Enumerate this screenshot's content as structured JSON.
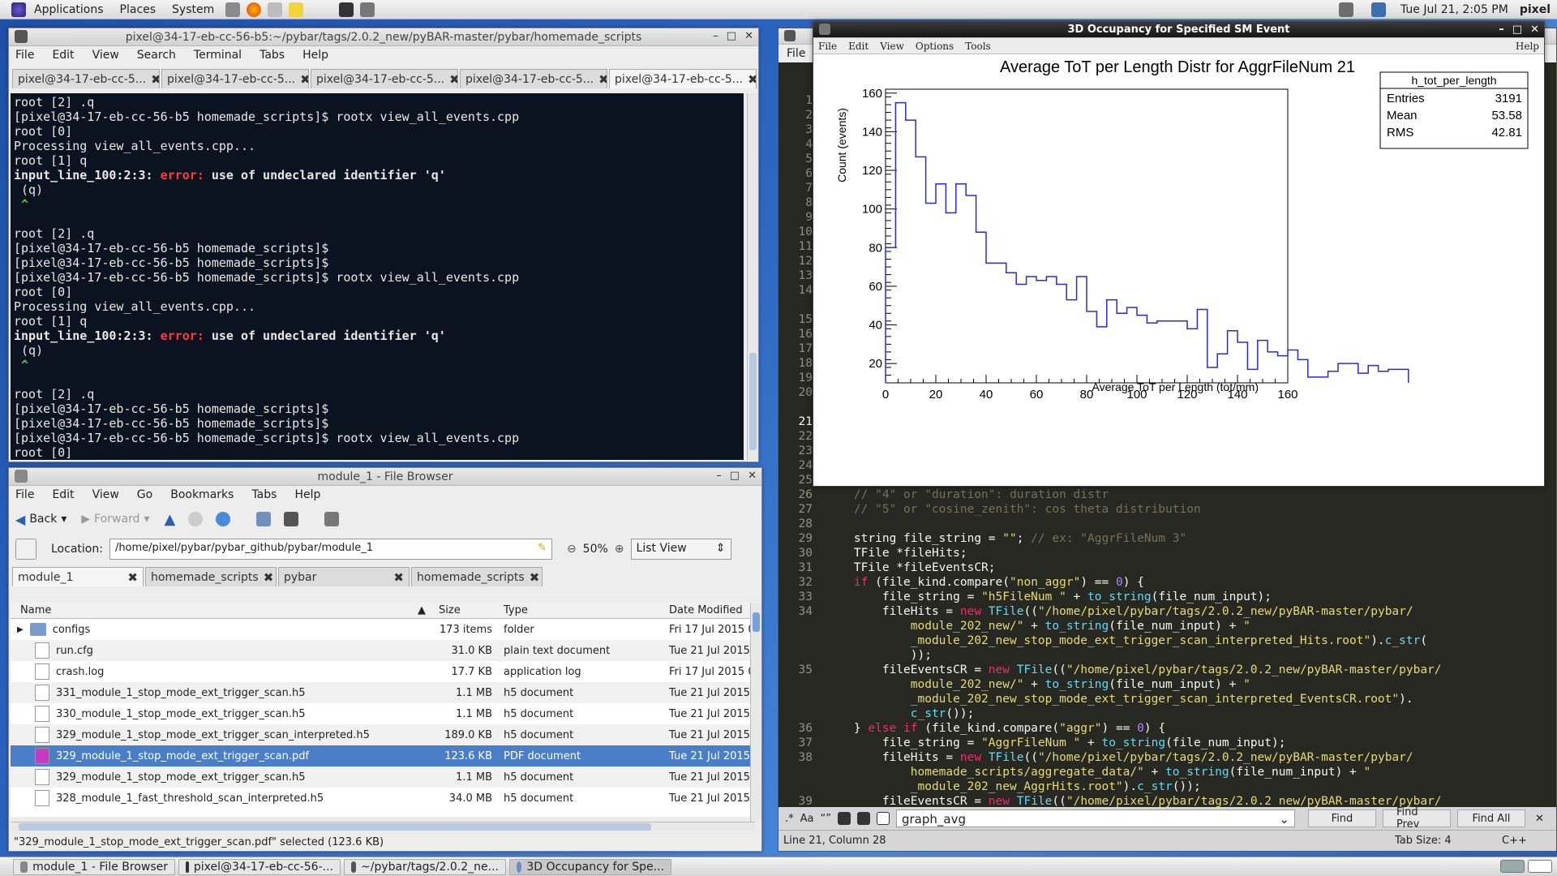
{
  "top_panel": {
    "menus": [
      "Applications",
      "Places",
      "System"
    ],
    "clock": "Tue Jul 21,  2:05 PM",
    "user": "pixel"
  },
  "terminal": {
    "title": "pixel@34-17-eb-cc-56-b5:~/pybar/tags/2.0.2_new/pyBAR-master/pybar/homemade_scripts",
    "menus": [
      "File",
      "Edit",
      "View",
      "Search",
      "Terminal",
      "Tabs",
      "Help"
    ],
    "tabs": [
      "pixel@34-17-eb-cc-5...",
      "pixel@34-17-eb-cc-5...",
      "pixel@34-17-eb-cc-5...",
      "pixel@34-17-eb-cc-5...",
      "pixel@34-17-eb-cc-5..."
    ],
    "lines": [
      {
        "t": "root [2] .q"
      },
      {
        "t": "[pixel@34-17-eb-cc-56-b5 homemade_scripts]$ rootx view_all_events.cpp"
      },
      {
        "t": "root [0]"
      },
      {
        "t": "Processing view_all_events.cpp..."
      },
      {
        "t": "root [1] q"
      },
      {
        "t": "input_line_100:2:3: ",
        "err": "error:",
        "rest": " use of undeclared identifier 'q'"
      },
      {
        "t": " (q)"
      },
      {
        "t": " ^",
        "caret": true
      },
      {
        "t": ""
      },
      {
        "t": "root [2] .q"
      },
      {
        "t": "[pixel@34-17-eb-cc-56-b5 homemade_scripts]$"
      },
      {
        "t": "[pixel@34-17-eb-cc-56-b5 homemade_scripts]$"
      },
      {
        "t": "[pixel@34-17-eb-cc-56-b5 homemade_scripts]$ rootx view_all_events.cpp"
      },
      {
        "t": "root [0]"
      },
      {
        "t": "Processing view_all_events.cpp..."
      },
      {
        "t": "root [1] q"
      },
      {
        "t": "input_line_100:2:3: ",
        "err": "error:",
        "rest": " use of undeclared identifier 'q'"
      },
      {
        "t": " (q)"
      },
      {
        "t": " ^",
        "caret": true
      },
      {
        "t": ""
      },
      {
        "t": "root [2] .q"
      },
      {
        "t": "[pixel@34-17-eb-cc-56-b5 homemade_scripts]$"
      },
      {
        "t": "[pixel@34-17-eb-cc-56-b5 homemade_scripts]$"
      },
      {
        "t": "[pixel@34-17-eb-cc-56-b5 homemade_scripts]$ rootx view_all_events.cpp"
      },
      {
        "t": "root [0]"
      },
      {
        "t": "Processing view_all_events.cpp..."
      },
      {
        "t": "root [1] ",
        "cursor": true
      }
    ]
  },
  "filebrowser": {
    "title": "module_1 - File Browser",
    "menus": [
      "File",
      "Edit",
      "View",
      "Go",
      "Bookmarks",
      "Tabs",
      "Help"
    ],
    "toolbar": {
      "back": "Back",
      "forward": "Forward"
    },
    "location_label": "Location:",
    "location": "/home/pixel/pybar/pybar_github/pybar/module_1",
    "zoom": "50%",
    "view_mode": "List View",
    "tabs": [
      "module_1",
      "homemade_scripts",
      "pybar",
      "homemade_scripts"
    ],
    "columns": {
      "name": "Name",
      "size": "Size",
      "type": "Type",
      "date": "Date Modified"
    },
    "rows": [
      {
        "name": "configs",
        "size": "173 items",
        "type": "folder",
        "date": "Fri 17 Jul 2015 0",
        "folder": true
      },
      {
        "name": "run.cfg",
        "size": "31.0 KB",
        "type": "plain text document",
        "date": "Tue 21 Jul 2015"
      },
      {
        "name": "crash.log",
        "size": "17.7 KB",
        "type": "application log",
        "date": "Fri 17 Jul 2015 0"
      },
      {
        "name": "331_module_1_stop_mode_ext_trigger_scan.h5",
        "size": "1.1 MB",
        "type": "h5 document",
        "date": "Tue 21 Jul 2015"
      },
      {
        "name": "330_module_1_stop_mode_ext_trigger_scan.h5",
        "size": "1.1 MB",
        "type": "h5 document",
        "date": "Tue 21 Jul 2015"
      },
      {
        "name": "329_module_1_stop_mode_ext_trigger_scan_interpreted.h5",
        "size": "189.0 KB",
        "type": "h5 document",
        "date": "Tue 21 Jul 2015"
      },
      {
        "name": "329_module_1_stop_mode_ext_trigger_scan.pdf",
        "size": "123.6 KB",
        "type": "PDF document",
        "date": "Tue 21 Jul 2015",
        "selected": true
      },
      {
        "name": "329_module_1_stop_mode_ext_trigger_scan.h5",
        "size": "1.1 MB",
        "type": "h5 document",
        "date": "Tue 21 Jul 2015"
      },
      {
        "name": "328_module_1_fast_threshold_scan_interpreted.h5",
        "size": "34.0 MB",
        "type": "h5 document",
        "date": "Tue 21 Jul 2015"
      }
    ],
    "status": "\"329_module_1_stop_mode_ext_trigger_scan.pdf\" selected (123.6 KB)"
  },
  "editor": {
    "menu_file": "File",
    "status": "Line 21, Column 28",
    "tab_size": "Tab Size: 4",
    "lang": "C++",
    "find_text": "graph_avg",
    "find_buttons": [
      "Find",
      "Find Prev",
      "Find All"
    ],
    "gutter_top": [
      "1",
      "2",
      "3",
      "4",
      "5",
      "6",
      "7",
      "8",
      "9",
      "10",
      "11",
      "12",
      "13",
      "14",
      "",
      "15",
      "16",
      "17",
      "18",
      "19",
      "20",
      "",
      "21",
      "22",
      "23",
      "24",
      "25"
    ],
    "code": [
      {
        "n": "26",
        "h": "<span class='cm'>    // \"4\" or \"duration\": duration distr</span>"
      },
      {
        "n": "27",
        "h": "<span class='cm'>    // \"5\" or \"cosine_zenith\": cos theta distribution</span>"
      },
      {
        "n": "28",
        "h": ""
      },
      {
        "n": "29",
        "h": "    string file_string = <span class='str'>\"\"</span>; <span class='cm'>// ex: \"AggrFileNum 3\"</span>"
      },
      {
        "n": "30",
        "h": "    TFile *fileHits;"
      },
      {
        "n": "31",
        "h": "    TFile *fileEventsCR;"
      },
      {
        "n": "32",
        "h": "    <span class='kw'>if</span> (file_kind.compare(<span class='str'>\"non_aggr\"</span>) == <span class='num'>0</span>) {"
      },
      {
        "n": "33",
        "h": "        file_string = <span class='str'>\"h5FileNum \"</span> + <span class='fn'>to_string</span>(file_num_input);"
      },
      {
        "n": "34",
        "h": "        fileHits = <span class='kw'>new</span> <span class='fn'>TFile</span>((<span class='str'>\"/home/pixel/pybar/tags/2.0.2_new/pyBAR-master/pybar/</span>"
      },
      {
        "n": "",
        "h": "<span class='str'>            module_202_new/\"</span> + <span class='fn'>to_string</span>(file_num_input) + <span class='str'>\"</span>"
      },
      {
        "n": "",
        "h": "<span class='str'>            _module_202_new_stop_mode_ext_trigger_scan_interpreted_Hits.root\"</span>).<span class='fn'>c_str</span>("
      },
      {
        "n": "",
        "h": "            ));"
      },
      {
        "n": "35",
        "h": "        fileEventsCR = <span class='kw'>new</span> <span class='fn'>TFile</span>((<span class='str'>\"/home/pixel/pybar/tags/2.0.2_new/pyBAR-master/pybar/</span>"
      },
      {
        "n": "",
        "h": "<span class='str'>            module_202_new/\"</span> + <span class='fn'>to_string</span>(file_num_input) + <span class='str'>\"</span>"
      },
      {
        "n": "",
        "h": "<span class='str'>            _module_202_new_stop_mode_ext_trigger_scan_interpreted_EventsCR.root\"</span>)."
      },
      {
        "n": "",
        "h": "            <span class='fn'>c_str</span>());"
      },
      {
        "n": "36",
        "h": "    } <span class='kw'>else if</span> (file_kind.compare(<span class='str'>\"aggr\"</span>) == <span class='num'>0</span>) {"
      },
      {
        "n": "37",
        "h": "        file_string = <span class='str'>\"AggrFileNum \"</span> + <span class='fn'>to_string</span>(file_num_input);"
      },
      {
        "n": "38",
        "h": "        fileHits = <span class='kw'>new</span> <span class='fn'>TFile</span>((<span class='str'>\"/home/pixel/pybar/tags/2.0.2_new/pyBAR-master/pybar/</span>"
      },
      {
        "n": "",
        "h": "<span class='str'>            homemade_scripts/aggregate_data/\"</span> + <span class='fn'>to_string</span>(file_num_input) + <span class='str'>\"</span>"
      },
      {
        "n": "",
        "h": "<span class='str'>            _module_202_new_AggrHits.root\"</span>).<span class='fn'>c_str</span>());"
      },
      {
        "n": "39",
        "h": "        fileEventsCR = <span class='kw'>new</span> <span class='fn'>TFile</span>((<span class='str'>\"/home/pixel/pybar/tags/2.0.2_new/pyBAR-master/pybar/</span>"
      }
    ]
  },
  "root_window": {
    "title": "3D Occupancy for Specified SM Event",
    "menus": [
      "File",
      "Edit",
      "View",
      "Options",
      "Tools"
    ],
    "help": "Help"
  },
  "stats_box": {
    "name": "h_tot_per_length",
    "rows": [
      [
        "Entries",
        "3191"
      ],
      [
        "Mean",
        "53.58"
      ],
      [
        "RMS",
        "42.81"
      ]
    ]
  },
  "chart_data": {
    "type": "histogram",
    "title": "Average ToT per Length Distr for AggrFileNum 21",
    "xlabel": "Average ToT per Length (tot/mm)",
    "ylabel": "Count (events)",
    "xlim": [
      0,
      160
    ],
    "ylim": [
      10,
      162
    ],
    "xticks": [
      "0",
      "20",
      "40",
      "60",
      "80",
      "100",
      "120",
      "140",
      "160"
    ],
    "yticks": [
      "20",
      "40",
      "60",
      "80",
      "100",
      "120",
      "140",
      "160"
    ],
    "bin_width": 4,
    "values": [
      80,
      155,
      146,
      127,
      103,
      113,
      98,
      113,
      107,
      88,
      72,
      72,
      67,
      61,
      65,
      63,
      65,
      61,
      53,
      65,
      47,
      39,
      53,
      46,
      49,
      45,
      41,
      42,
      42,
      42,
      38,
      48,
      18,
      25,
      37,
      31,
      17,
      32,
      26,
      24,
      27,
      22,
      13,
      13,
      16,
      20,
      20,
      15,
      19,
      16,
      17,
      17
    ],
    "line_color": "#2a2ad6"
  },
  "taskbar": {
    "items": [
      "module_1 - File Browser",
      "pixel@34-17-eb-cc-56-...",
      "~/pybar/tags/2.0.2_ne...",
      "3D Occupancy for Spe..."
    ]
  }
}
